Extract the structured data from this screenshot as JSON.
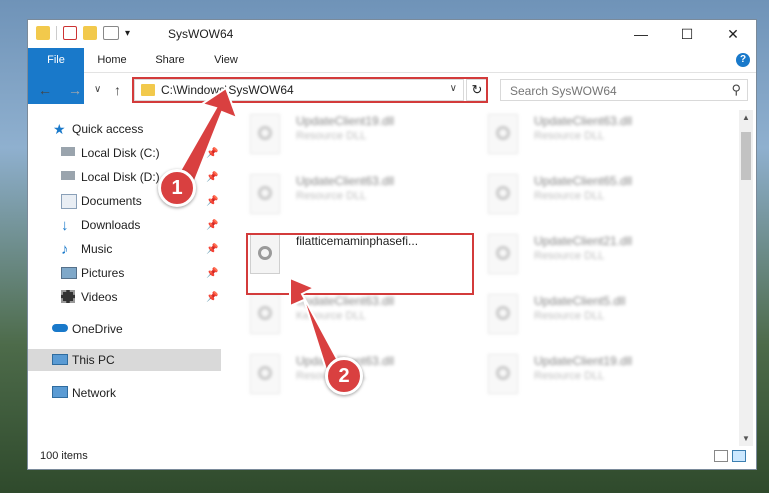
{
  "window": {
    "title": "SysWOW64",
    "minimize": "—",
    "maximize": "☐",
    "close": "✕"
  },
  "ribbon": {
    "tabs": [
      "File",
      "Home",
      "Share",
      "View"
    ],
    "help": "?"
  },
  "address": {
    "path": "C:\\Windows\\SysWOW64",
    "dropdown": "∨",
    "refresh": "↻"
  },
  "search": {
    "placeholder": "Search SysWOW64",
    "icon": "search-icon"
  },
  "nav": {
    "back": "←",
    "forward": "→",
    "recent": "∨",
    "up": "↑",
    "items": [
      {
        "label": "Quick access",
        "icon": "star-icon",
        "pinned": false
      },
      {
        "label": "Local Disk (C:)",
        "icon": "drive-icon",
        "pinned": true
      },
      {
        "label": "Local Disk (D:)",
        "icon": "drive-icon",
        "pinned": true
      },
      {
        "label": "Documents",
        "icon": "documents-icon",
        "pinned": true
      },
      {
        "label": "Downloads",
        "icon": "download-icon",
        "pinned": true
      },
      {
        "label": "Music",
        "icon": "music-icon",
        "pinned": true
      },
      {
        "label": "Pictures",
        "icon": "pictures-icon",
        "pinned": true
      },
      {
        "label": "Videos",
        "icon": "videos-icon",
        "pinned": true
      },
      {
        "label": "OneDrive",
        "icon": "cloud-icon",
        "pinned": false
      },
      {
        "label": "This PC",
        "icon": "pc-icon",
        "pinned": false,
        "selected": true
      },
      {
        "label": "Network",
        "icon": "network-icon",
        "pinned": false
      }
    ]
  },
  "files": [
    {
      "name": "UpdateClient19.dll",
      "type": "Resource DLL",
      "faded": true
    },
    {
      "name": "UpdateClient63.dll",
      "type": "Resource DLL",
      "faded": true
    },
    {
      "name": "UpdateClient63.dll",
      "type": "Resource DLL",
      "faded": true
    },
    {
      "name": "UpdateClient65.dll",
      "type": "Resource DLL",
      "faded": true
    },
    {
      "name": "filatticemaminphasefi...",
      "type": "",
      "faded": false
    },
    {
      "name": "UpdateClient21.dll",
      "type": "Resource DLL",
      "faded": true
    },
    {
      "name": "UpdateClient63.dll",
      "type": "Kesource DLL",
      "faded": true
    },
    {
      "name": "UpdateClient5.dll",
      "type": "Resource DLL",
      "faded": true
    },
    {
      "name": "UpdateClient63.dll",
      "type": "Resource DLL",
      "faded": true
    },
    {
      "name": "UpdateClient19.dll",
      "type": "Resource DLL",
      "faded": true
    }
  ],
  "annotations": {
    "step1": "1",
    "step2": "2",
    "color": "#d33b3b"
  },
  "status": {
    "count": "100 items"
  }
}
